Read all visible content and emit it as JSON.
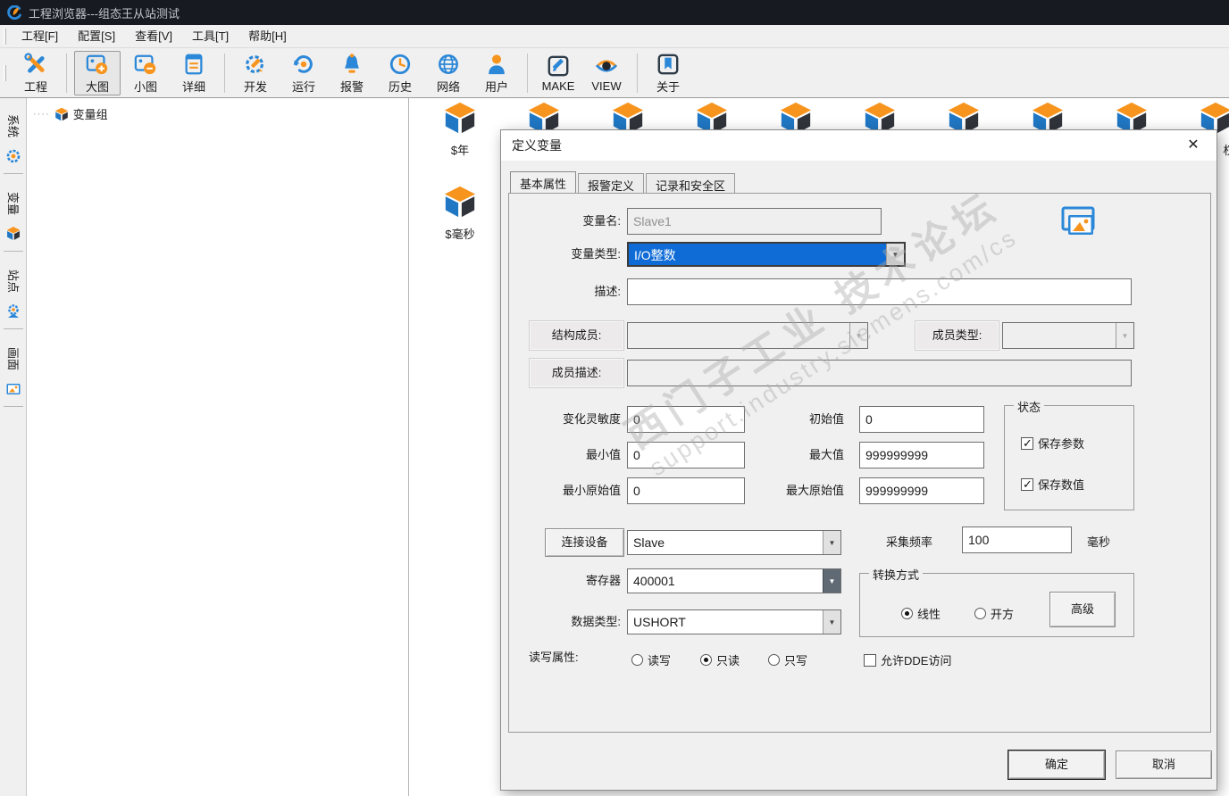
{
  "window": {
    "title": "工程浏览器---组态王从站测试"
  },
  "menu": {
    "items": [
      {
        "label": "工程[F]"
      },
      {
        "label": "配置[S]"
      },
      {
        "label": "查看[V]"
      },
      {
        "label": "工具[T]"
      },
      {
        "label": "帮助[H]"
      }
    ]
  },
  "toolbar": {
    "items": [
      {
        "label": "工程",
        "icon": "tools-icon"
      },
      {
        "label": "大图",
        "icon": "picture-large-icon",
        "selected": true
      },
      {
        "label": "小图",
        "icon": "picture-small-icon"
      },
      {
        "label": "详细",
        "icon": "detail-icon"
      },
      {
        "label": "开发",
        "icon": "develop-icon"
      },
      {
        "label": "运行",
        "icon": "run-icon"
      },
      {
        "label": "报警",
        "icon": "alarm-icon"
      },
      {
        "label": "历史",
        "icon": "history-icon"
      },
      {
        "label": "网络",
        "icon": "network-icon"
      },
      {
        "label": "用户",
        "icon": "user-icon"
      },
      {
        "label": "MAKE",
        "icon": "make-icon"
      },
      {
        "label": "VIEW",
        "icon": "view-icon"
      },
      {
        "label": "关于",
        "icon": "about-icon"
      }
    ]
  },
  "sidebar": {
    "tabs": [
      {
        "label": "系统",
        "icon": "gear-icon"
      },
      {
        "label": "变量",
        "icon": "cube-icon"
      },
      {
        "label": "站点",
        "icon": "station-icon"
      },
      {
        "label": "画面",
        "icon": "picture-icon"
      }
    ]
  },
  "tree": {
    "root_label": "变量组"
  },
  "main": {
    "item1_label": "$年",
    "item2_label": "$毫秒",
    "clipped_label": "权"
  },
  "colors": {
    "accent_blue": "#2077c4",
    "accent_orange": "#f7941d",
    "combo_highlight": "#0f6cd6",
    "titlebar": "#171a20"
  },
  "dialog": {
    "title": "定义变量",
    "tabs": [
      {
        "label": "基本属性"
      },
      {
        "label": "报警定义"
      },
      {
        "label": "记录和安全区"
      }
    ],
    "fields": {
      "var_name": {
        "label": "变量名:",
        "value": "Slave1"
      },
      "var_type": {
        "label": "变量类型:",
        "value": "I/O整数"
      },
      "description": {
        "label": "描述:",
        "value": ""
      },
      "struct_member": {
        "label": "结构成员:",
        "value": ""
      },
      "member_type": {
        "label": "成员类型:",
        "value": ""
      },
      "member_desc": {
        "label": "成员描述:",
        "value": ""
      },
      "sensitivity": {
        "label": "变化灵敏度",
        "value": "0"
      },
      "init_value": {
        "label": "初始值",
        "value": "0"
      },
      "min_value": {
        "label": "最小值",
        "value": "0"
      },
      "max_value": {
        "label": "最大值",
        "value": "999999999"
      },
      "min_raw": {
        "label": "最小原始值",
        "value": "0"
      },
      "max_raw": {
        "label": "最大原始值",
        "value": "999999999"
      },
      "device": {
        "label": "连接设备",
        "value": "Slave"
      },
      "freq": {
        "label": "采集频率",
        "value": "100",
        "unit": "毫秒"
      },
      "register": {
        "label": "寄存器",
        "value": "400001"
      },
      "data_type": {
        "label": "数据类型:",
        "value": "USHORT"
      }
    },
    "state_group": {
      "title": "状态",
      "save_params": {
        "label": "保存参数",
        "checked": true
      },
      "save_values": {
        "label": "保存数值",
        "checked": true
      }
    },
    "convert_group": {
      "title": "转换方式",
      "linear": {
        "label": "线性",
        "selected": true
      },
      "sqrt": {
        "label": "开方",
        "selected": false
      },
      "advanced_label": "高级"
    },
    "rw_group": {
      "label": "读写属性:",
      "read_write": {
        "label": "读写",
        "selected": false
      },
      "read_only": {
        "label": "只读",
        "selected": true
      },
      "write_only": {
        "label": "只写",
        "selected": false
      },
      "dde": {
        "label": "允许DDE访问",
        "checked": false
      }
    },
    "buttons": {
      "ok": "确定",
      "cancel": "取消"
    },
    "watermark": {
      "line1": "西门子工业  技术论坛",
      "line2": "support.industry.siemens.com/cs"
    }
  }
}
